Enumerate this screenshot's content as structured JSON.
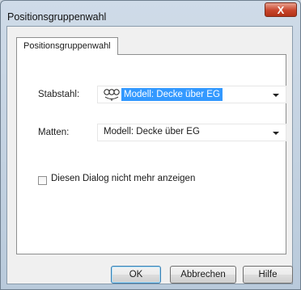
{
  "window": {
    "title": "Positionsgruppenwahl",
    "close_glyph": "X"
  },
  "tabs": [
    {
      "label": "Positionsgruppenwahl",
      "active": true
    }
  ],
  "form": {
    "stabstahl": {
      "label": "Stabstahl:",
      "value": "Modell: Decke über EG",
      "icon": "position-group-icon",
      "selected": true
    },
    "matten": {
      "label": "Matten:",
      "value": "Modell: Decke über EG"
    },
    "dont_show": {
      "label": "Diesen Dialog nicht mehr anzeigen",
      "checked": false
    }
  },
  "buttons": {
    "ok": "OK",
    "cancel": "Abbrechen",
    "help": "Hilfe"
  },
  "colors": {
    "selection": "#3399ff",
    "close_button": "#c8452c",
    "titlebar": "#c4d3e2"
  }
}
